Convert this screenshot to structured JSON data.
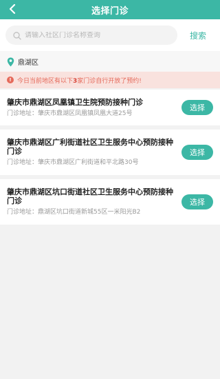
{
  "header": {
    "title": "选择门诊",
    "back_icon": "chevron-left-icon"
  },
  "search": {
    "placeholder": "请输入社区门诊名称查询",
    "button_label": "搜索",
    "icon": "search-icon"
  },
  "district": {
    "label": "鼎湖区",
    "icon": "location-pin-icon"
  },
  "notice": {
    "prefix": "今日当前地区有以下",
    "count": "3",
    "suffix": "家门诊自行开放了预约!",
    "icon": "alert-icon"
  },
  "clinics": [
    {
      "name": "肇庆市鼎湖区凤凰镇卫生院预防接种门诊",
      "address": "门诊地址：肇庆市鼎湖区凤凰镇凤凰大道25号",
      "button_label": "选择"
    },
    {
      "name": "肇庆市鼎湖区广利街道社区卫生服务中心预防接种门诊",
      "address": "门诊地址：肇庆市鼎湖区广利街道和平北路30号",
      "button_label": "选择"
    },
    {
      "name": "肇庆市鼎湖区坑口街道社区卫生服务中心预防接种门诊",
      "address": "门诊地址：鼎湖区坑口街道新城55区一米阳光B2",
      "button_label": "选择"
    }
  ],
  "colors": {
    "primary": "#3cb7a5",
    "notice_bg": "#f9e2de",
    "notice_text": "#e56a5b"
  }
}
